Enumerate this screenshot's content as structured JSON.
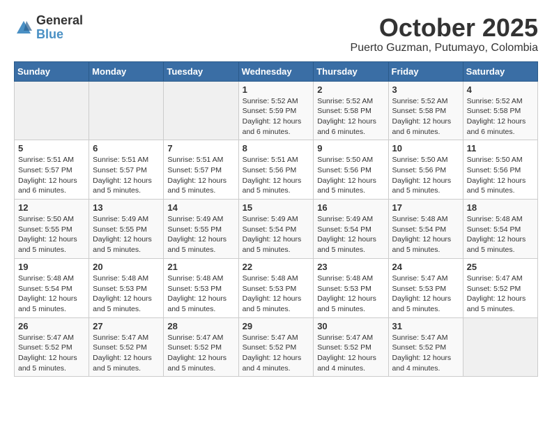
{
  "header": {
    "logo_general": "General",
    "logo_blue": "Blue",
    "month": "October 2025",
    "location": "Puerto Guzman, Putumayo, Colombia"
  },
  "weekdays": [
    "Sunday",
    "Monday",
    "Tuesday",
    "Wednesday",
    "Thursday",
    "Friday",
    "Saturday"
  ],
  "weeks": [
    [
      {
        "day": "",
        "info": ""
      },
      {
        "day": "",
        "info": ""
      },
      {
        "day": "",
        "info": ""
      },
      {
        "day": "1",
        "info": "Sunrise: 5:52 AM\nSunset: 5:59 PM\nDaylight: 12 hours\nand 6 minutes."
      },
      {
        "day": "2",
        "info": "Sunrise: 5:52 AM\nSunset: 5:58 PM\nDaylight: 12 hours\nand 6 minutes."
      },
      {
        "day": "3",
        "info": "Sunrise: 5:52 AM\nSunset: 5:58 PM\nDaylight: 12 hours\nand 6 minutes."
      },
      {
        "day": "4",
        "info": "Sunrise: 5:52 AM\nSunset: 5:58 PM\nDaylight: 12 hours\nand 6 minutes."
      }
    ],
    [
      {
        "day": "5",
        "info": "Sunrise: 5:51 AM\nSunset: 5:57 PM\nDaylight: 12 hours\nand 6 minutes."
      },
      {
        "day": "6",
        "info": "Sunrise: 5:51 AM\nSunset: 5:57 PM\nDaylight: 12 hours\nand 5 minutes."
      },
      {
        "day": "7",
        "info": "Sunrise: 5:51 AM\nSunset: 5:57 PM\nDaylight: 12 hours\nand 5 minutes."
      },
      {
        "day": "8",
        "info": "Sunrise: 5:51 AM\nSunset: 5:56 PM\nDaylight: 12 hours\nand 5 minutes."
      },
      {
        "day": "9",
        "info": "Sunrise: 5:50 AM\nSunset: 5:56 PM\nDaylight: 12 hours\nand 5 minutes."
      },
      {
        "day": "10",
        "info": "Sunrise: 5:50 AM\nSunset: 5:56 PM\nDaylight: 12 hours\nand 5 minutes."
      },
      {
        "day": "11",
        "info": "Sunrise: 5:50 AM\nSunset: 5:56 PM\nDaylight: 12 hours\nand 5 minutes."
      }
    ],
    [
      {
        "day": "12",
        "info": "Sunrise: 5:50 AM\nSunset: 5:55 PM\nDaylight: 12 hours\nand 5 minutes."
      },
      {
        "day": "13",
        "info": "Sunrise: 5:49 AM\nSunset: 5:55 PM\nDaylight: 12 hours\nand 5 minutes."
      },
      {
        "day": "14",
        "info": "Sunrise: 5:49 AM\nSunset: 5:55 PM\nDaylight: 12 hours\nand 5 minutes."
      },
      {
        "day": "15",
        "info": "Sunrise: 5:49 AM\nSunset: 5:54 PM\nDaylight: 12 hours\nand 5 minutes."
      },
      {
        "day": "16",
        "info": "Sunrise: 5:49 AM\nSunset: 5:54 PM\nDaylight: 12 hours\nand 5 minutes."
      },
      {
        "day": "17",
        "info": "Sunrise: 5:48 AM\nSunset: 5:54 PM\nDaylight: 12 hours\nand 5 minutes."
      },
      {
        "day": "18",
        "info": "Sunrise: 5:48 AM\nSunset: 5:54 PM\nDaylight: 12 hours\nand 5 minutes."
      }
    ],
    [
      {
        "day": "19",
        "info": "Sunrise: 5:48 AM\nSunset: 5:54 PM\nDaylight: 12 hours\nand 5 minutes."
      },
      {
        "day": "20",
        "info": "Sunrise: 5:48 AM\nSunset: 5:53 PM\nDaylight: 12 hours\nand 5 minutes."
      },
      {
        "day": "21",
        "info": "Sunrise: 5:48 AM\nSunset: 5:53 PM\nDaylight: 12 hours\nand 5 minutes."
      },
      {
        "day": "22",
        "info": "Sunrise: 5:48 AM\nSunset: 5:53 PM\nDaylight: 12 hours\nand 5 minutes."
      },
      {
        "day": "23",
        "info": "Sunrise: 5:48 AM\nSunset: 5:53 PM\nDaylight: 12 hours\nand 5 minutes."
      },
      {
        "day": "24",
        "info": "Sunrise: 5:47 AM\nSunset: 5:53 PM\nDaylight: 12 hours\nand 5 minutes."
      },
      {
        "day": "25",
        "info": "Sunrise: 5:47 AM\nSunset: 5:52 PM\nDaylight: 12 hours\nand 5 minutes."
      }
    ],
    [
      {
        "day": "26",
        "info": "Sunrise: 5:47 AM\nSunset: 5:52 PM\nDaylight: 12 hours\nand 5 minutes."
      },
      {
        "day": "27",
        "info": "Sunrise: 5:47 AM\nSunset: 5:52 PM\nDaylight: 12 hours\nand 5 minutes."
      },
      {
        "day": "28",
        "info": "Sunrise: 5:47 AM\nSunset: 5:52 PM\nDaylight: 12 hours\nand 5 minutes."
      },
      {
        "day": "29",
        "info": "Sunrise: 5:47 AM\nSunset: 5:52 PM\nDaylight: 12 hours\nand 4 minutes."
      },
      {
        "day": "30",
        "info": "Sunrise: 5:47 AM\nSunset: 5:52 PM\nDaylight: 12 hours\nand 4 minutes."
      },
      {
        "day": "31",
        "info": "Sunrise: 5:47 AM\nSunset: 5:52 PM\nDaylight: 12 hours\nand 4 minutes."
      },
      {
        "day": "",
        "info": ""
      }
    ]
  ]
}
